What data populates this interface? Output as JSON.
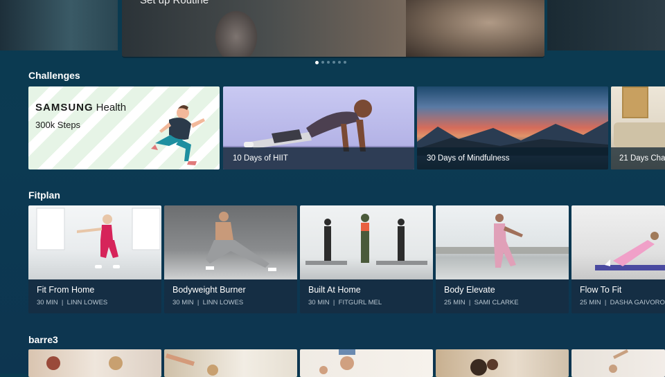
{
  "hero": {
    "title": "Set up Routine",
    "page_count": 6,
    "active_page": 1
  },
  "sections": {
    "challenges": "Challenges",
    "fitplan": "Fitplan",
    "barre3": "barre3"
  },
  "challenges": {
    "samsung": {
      "brand": "SAMSUNG",
      "brand_suffix": "Health",
      "steps": "300k Steps"
    },
    "items": [
      {
        "label": "10 Days of HIIT"
      },
      {
        "label": "30 Days of Mindfulness"
      },
      {
        "label": "21 Days Cha"
      }
    ]
  },
  "fitplan": [
    {
      "title": "Fit From Home",
      "duration": "30 MIN",
      "trainer": "LINN LOWES"
    },
    {
      "title": "Bodyweight Burner",
      "duration": "30 MIN",
      "trainer": "LINN LOWES"
    },
    {
      "title": "Built At Home",
      "duration": "30 MIN",
      "trainer": "FITGURL MEL"
    },
    {
      "title": "Body Elevate",
      "duration": "25 MIN",
      "trainer": "SAMI CLARKE"
    },
    {
      "title": "Flow To Fit",
      "duration": "25 MIN",
      "trainer": "DASHA GAIVORONSKI"
    }
  ],
  "colors": {
    "background": "#0c3a52",
    "caption_bg": "#152e44",
    "accent_dot": "#ffffff"
  }
}
